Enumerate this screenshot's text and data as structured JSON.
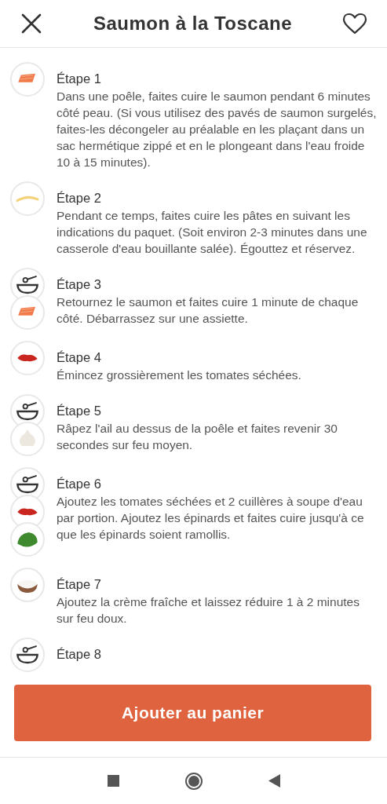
{
  "header": {
    "title": "Saumon à la Toscane"
  },
  "steps": [
    {
      "title": "Étape 1",
      "text": "Dans une poêle, faites cuire le saumon pendant 6 minutes côté peau. (Si vous utilisez des pavés de saumon surgelés, faites-les décongeler au préalable en les plaçant dans un sac hermétique zippé et en le plongeant dans l'eau froide 10 à 15 minutes).",
      "icons": [
        {
          "kind": "salmon"
        }
      ]
    },
    {
      "title": "Étape 2",
      "text": "Pendant ce temps, faites cuire les pâtes en suivant les indications du paquet. (Soit environ 2-3 minutes dans une casserole d'eau bouillante salée). Égouttez et réservez.",
      "icons": [
        {
          "kind": "pasta"
        }
      ]
    },
    {
      "title": "Étape 3",
      "text": "Retournez le saumon et faites cuire 1 minute de chaque côté. Débarrassez sur une assiette.",
      "icons": [
        {
          "kind": "bowl"
        },
        {
          "kind": "salmon"
        }
      ]
    },
    {
      "title": "Étape 4",
      "text": "Émincez grossièrement les tomates séchées.",
      "icons": [
        {
          "kind": "tomato"
        }
      ]
    },
    {
      "title": "Étape 5",
      "text": "Râpez l'ail au dessus de la poêle et faites revenir 30 secondes sur feu moyen.",
      "icons": [
        {
          "kind": "bowl"
        },
        {
          "kind": "garlic"
        }
      ]
    },
    {
      "title": "Étape 6",
      "text": "Ajoutez les tomates séchées et 2 cuillères à soupe d'eau par portion. Ajoutez les épinards et faites cuire jusqu'à ce que les épinards soient ramollis.",
      "icons": [
        {
          "kind": "bowl"
        },
        {
          "kind": "tomato"
        },
        {
          "kind": "spinach"
        }
      ]
    },
    {
      "title": "Étape 7",
      "text": "Ajoutez la crème fraîche et laissez réduire 1 à 2 minutes sur feu doux.",
      "icons": [
        {
          "kind": "cream"
        }
      ]
    },
    {
      "title": "Étape 8",
      "icons": [
        {
          "kind": "bowl"
        }
      ]
    }
  ],
  "cart_button": {
    "label": "Ajouter au panier"
  }
}
